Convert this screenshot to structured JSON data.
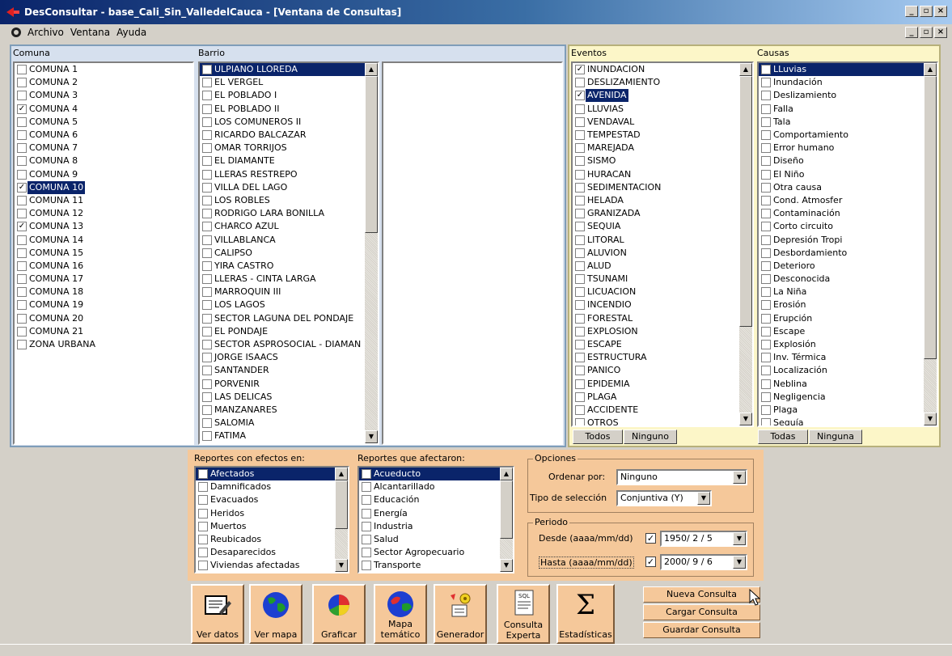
{
  "window": {
    "title": "DesConsultar - base_Cali_Sin_ValledelCauca - [Ventana de Consultas]"
  },
  "menu": [
    "Archivo",
    "Ventana",
    "Ayuda"
  ],
  "comuna": {
    "header": "Comuna",
    "items": [
      {
        "label": "COMUNA 1",
        "checked": false
      },
      {
        "label": "COMUNA 2",
        "checked": false
      },
      {
        "label": "COMUNA 3",
        "checked": false
      },
      {
        "label": "COMUNA 4",
        "checked": true
      },
      {
        "label": "COMUNA 5",
        "checked": false
      },
      {
        "label": "COMUNA 6",
        "checked": false
      },
      {
        "label": "COMUNA 7",
        "checked": false
      },
      {
        "label": "COMUNA 8",
        "checked": false
      },
      {
        "label": "COMUNA 9",
        "checked": false
      },
      {
        "label": "COMUNA 10",
        "checked": true,
        "selected": true
      },
      {
        "label": "COMUNA 11",
        "checked": false
      },
      {
        "label": "COMUNA 12",
        "checked": false
      },
      {
        "label": "COMUNA 13",
        "checked": true
      },
      {
        "label": "COMUNA 14",
        "checked": false
      },
      {
        "label": "COMUNA 15",
        "checked": false
      },
      {
        "label": "COMUNA 16",
        "checked": false
      },
      {
        "label": "COMUNA 17",
        "checked": false
      },
      {
        "label": "COMUNA 18",
        "checked": false
      },
      {
        "label": "COMUNA 19",
        "checked": false
      },
      {
        "label": "COMUNA 20",
        "checked": false
      },
      {
        "label": "COMUNA 21",
        "checked": false
      },
      {
        "label": "ZONA URBANA",
        "checked": false
      }
    ]
  },
  "barrio": {
    "header": "Barrio",
    "items": [
      {
        "label": "ULPIANO LLOREDA",
        "selected": true
      },
      {
        "label": "EL VERGEL"
      },
      {
        "label": "EL POBLADO I"
      },
      {
        "label": "EL POBLADO II"
      },
      {
        "label": "LOS COMUNEROS II"
      },
      {
        "label": "RICARDO BALCAZAR"
      },
      {
        "label": "OMAR TORRIJOS"
      },
      {
        "label": "EL DIAMANTE"
      },
      {
        "label": "LLERAS RESTREPO"
      },
      {
        "label": "VILLA DEL LAGO"
      },
      {
        "label": "LOS ROBLES"
      },
      {
        "label": "RODRIGO LARA BONILLA"
      },
      {
        "label": "CHARCO AZUL"
      },
      {
        "label": "VILLABLANCA"
      },
      {
        "label": "CALIPSO"
      },
      {
        "label": "YIRA CASTRO"
      },
      {
        "label": "LLERAS - CINTA LARGA"
      },
      {
        "label": "MARROQUIN III"
      },
      {
        "label": "LOS LAGOS"
      },
      {
        "label": "SECTOR LAGUNA DEL PONDAJE"
      },
      {
        "label": "EL PONDAJE"
      },
      {
        "label": "SECTOR ASPROSOCIAL - DIAMAN"
      },
      {
        "label": "JORGE ISAACS"
      },
      {
        "label": "SANTANDER"
      },
      {
        "label": "PORVENIR"
      },
      {
        "label": "LAS DELICAS"
      },
      {
        "label": "MANZANARES"
      },
      {
        "label": "SALOMIA"
      },
      {
        "label": "FATIMA"
      }
    ]
  },
  "eventos": {
    "header": "Eventos",
    "items": [
      {
        "label": "INUNDACION",
        "checked": true
      },
      {
        "label": "DESLIZAMIENTO"
      },
      {
        "label": "AVENIDA",
        "checked": true,
        "selected": true
      },
      {
        "label": "LLUVIAS"
      },
      {
        "label": "VENDAVAL"
      },
      {
        "label": "TEMPESTAD"
      },
      {
        "label": "MAREJADA"
      },
      {
        "label": "SISMO"
      },
      {
        "label": "HURACAN"
      },
      {
        "label": "SEDIMENTACION"
      },
      {
        "label": "HELADA"
      },
      {
        "label": "GRANIZADA"
      },
      {
        "label": "SEQUIA"
      },
      {
        "label": "LITORAL"
      },
      {
        "label": "ALUVION"
      },
      {
        "label": "ALUD"
      },
      {
        "label": "TSUNAMI"
      },
      {
        "label": "LICUACION"
      },
      {
        "label": "INCENDIO"
      },
      {
        "label": "FORESTAL"
      },
      {
        "label": "EXPLOSION"
      },
      {
        "label": "ESCAPE"
      },
      {
        "label": "ESTRUCTURA"
      },
      {
        "label": "PANICO"
      },
      {
        "label": "EPIDEMIA"
      },
      {
        "label": "PLAGA"
      },
      {
        "label": "ACCIDENTE"
      },
      {
        "label": "OTROS"
      }
    ],
    "btn_all": "Todos",
    "btn_none": "Ninguno"
  },
  "causas": {
    "header": "Causas",
    "items": [
      {
        "label": "LLuvias",
        "selected": true
      },
      {
        "label": "Inundación"
      },
      {
        "label": "Deslizamiento"
      },
      {
        "label": "Falla"
      },
      {
        "label": "Tala"
      },
      {
        "label": "Comportamiento"
      },
      {
        "label": "Error humano"
      },
      {
        "label": "Diseño"
      },
      {
        "label": "El Niño"
      },
      {
        "label": "Otra causa"
      },
      {
        "label": "Cond. Atmosfer"
      },
      {
        "label": "Contaminación"
      },
      {
        "label": "Corto circuito"
      },
      {
        "label": "Depresión Tropi"
      },
      {
        "label": "Desbordamiento"
      },
      {
        "label": "Deterioro"
      },
      {
        "label": "Desconocida"
      },
      {
        "label": "La Niña"
      },
      {
        "label": "Erosión"
      },
      {
        "label": "Erupción"
      },
      {
        "label": "Escape"
      },
      {
        "label": "Explosión"
      },
      {
        "label": "Inv. Térmica"
      },
      {
        "label": "Localización"
      },
      {
        "label": "Neblina"
      },
      {
        "label": "Negligencia"
      },
      {
        "label": "Plaga"
      },
      {
        "label": "Sequía"
      }
    ],
    "btn_all": "Todas",
    "btn_none": "Ninguna"
  },
  "efectos": {
    "header": "Reportes con efectos en:",
    "items": [
      {
        "label": "Afectados",
        "selected": true
      },
      {
        "label": "Damnificados"
      },
      {
        "label": "Evacuados"
      },
      {
        "label": "Heridos"
      },
      {
        "label": "Muertos"
      },
      {
        "label": "Reubicados"
      },
      {
        "label": "Desaparecidos"
      },
      {
        "label": "Viviendas afectadas"
      }
    ]
  },
  "afectaron": {
    "header": "Reportes que afectaron:",
    "items": [
      {
        "label": "Acueducto",
        "selected": true
      },
      {
        "label": "Alcantarillado"
      },
      {
        "label": "Educación"
      },
      {
        "label": "Energía"
      },
      {
        "label": "Industria"
      },
      {
        "label": "Salud"
      },
      {
        "label": "Sector Agropecuario"
      },
      {
        "label": "Transporte"
      }
    ]
  },
  "opciones": {
    "legend": "Opciones",
    "ordenar_label": "Ordenar por:",
    "ordenar_value": "Ninguno",
    "tipo_label": "Tipo de selección",
    "tipo_value": "Conjuntiva (Y)"
  },
  "periodo": {
    "legend": "Periodo",
    "desde_label": "Desde (aaaa/mm/dd)",
    "desde_value": "1950/ 2 / 5",
    "hasta_label": "Hasta (aaaa/mm/dd)",
    "hasta_value": "2000/ 9 / 6"
  },
  "toolbar": [
    {
      "label": "Ver datos",
      "icon": "edit-data-icon"
    },
    {
      "label": "Ver mapa",
      "icon": "globe-icon"
    },
    {
      "label": "Graficar",
      "icon": "pie-chart-icon"
    },
    {
      "label": "Mapa temático",
      "icon": "globe-icon"
    },
    {
      "label": "Generador",
      "icon": "generator-icon"
    },
    {
      "label": "Consulta Experta",
      "icon": "sql-document-icon",
      "badge": "SQL"
    },
    {
      "label": "Estadísticas",
      "icon": "sigma-icon",
      "glyph": "Σ"
    }
  ],
  "query_buttons": {
    "nueva": "Nueva Consulta",
    "cargar": "Cargar Consulta",
    "guardar": "Guardar Consulta"
  },
  "colors": {
    "selection": "#0a246a",
    "left_panel": "#d6e0ee",
    "right_panel": "#fcf6c8",
    "bottom_panel": "#f5c89a"
  }
}
